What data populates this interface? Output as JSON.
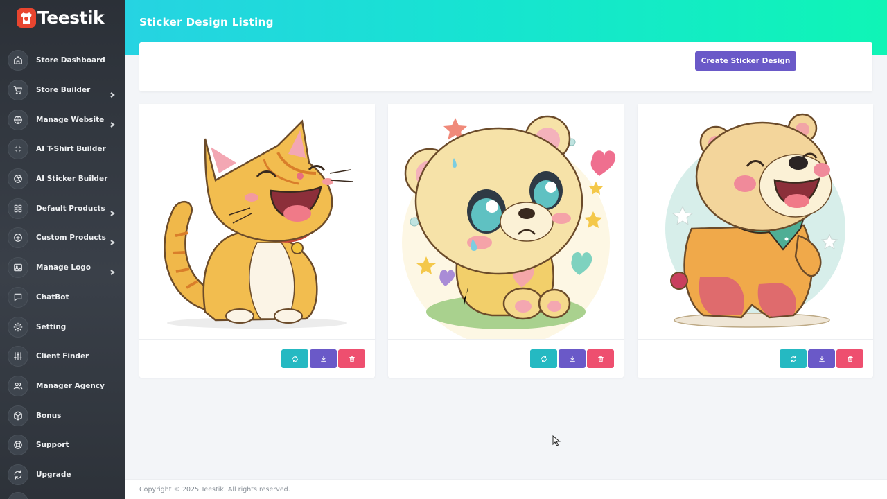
{
  "brand": {
    "name": "Teestik",
    "accent": "#e8452f"
  },
  "sidebar": {
    "items": [
      {
        "label": "Store Dashboard",
        "icon": "home-icon",
        "chevron": false
      },
      {
        "label": "Store Builder",
        "icon": "cart-icon",
        "chevron": true
      },
      {
        "label": "Manage Website",
        "icon": "globe-icon",
        "chevron": true
      },
      {
        "label": "AI T-Shirt Builder",
        "icon": "shrink-icon",
        "chevron": false
      },
      {
        "label": "AI Sticker Builder",
        "icon": "aperture-icon",
        "chevron": false
      },
      {
        "label": "Default Products",
        "icon": "grid-icon",
        "chevron": true
      },
      {
        "label": "Custom Products",
        "icon": "plus-circle-icon",
        "chevron": true
      },
      {
        "label": "Manage Logo",
        "icon": "image-icon",
        "chevron": true
      },
      {
        "label": "ChatBot",
        "icon": "chat-icon",
        "chevron": false
      },
      {
        "label": "Setting",
        "icon": "gear-icon",
        "chevron": false
      },
      {
        "label": "Client Finder",
        "icon": "sliders-icon",
        "chevron": false
      },
      {
        "label": "Manager Agency",
        "icon": "users-icon",
        "chevron": false
      },
      {
        "label": "Bonus",
        "icon": "box-icon",
        "chevron": false
      },
      {
        "label": "Support",
        "icon": "lifebuoy-icon",
        "chevron": false
      },
      {
        "label": "Upgrade",
        "icon": "refresh-icon",
        "chevron": false
      }
    ]
  },
  "header": {
    "title": "Sticker Design Listing"
  },
  "toolbar": {
    "create_label": "Create Sticker Design"
  },
  "stickers": [
    {
      "subject": "laughing-cat"
    },
    {
      "subject": "crying-bear"
    },
    {
      "subject": "laughing-bear"
    }
  ],
  "colors": {
    "header_start": "#26d3e2",
    "header_end": "#0ff5b6",
    "primary": "#6a59c8",
    "regenerate": "#25b9c2",
    "delete": "#ee4f6f",
    "sidebar": "#2b3037"
  },
  "footer": {
    "copyright": "Copyright © 2025 Teestik. All rights reserved."
  }
}
